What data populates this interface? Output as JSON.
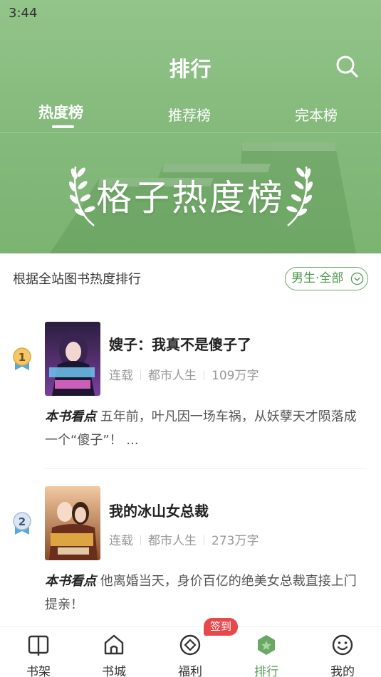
{
  "status_bar": {
    "time": "3:44"
  },
  "header": {
    "title": "排行",
    "tabs": [
      {
        "label": "热度榜",
        "active": true
      },
      {
        "label": "推荐榜",
        "active": false
      },
      {
        "label": "完本榜",
        "active": false
      }
    ],
    "banner_title": "格子热度榜"
  },
  "list": {
    "description": "根据全站图书热度排行",
    "filter_label": "男生·全部"
  },
  "books": [
    {
      "rank": "1",
      "title": "嫂子：我真不是傻子了",
      "status": "连载",
      "category": "都市人生",
      "words": "109万字",
      "blurb_tag": "本书看点",
      "blurb": "五年前，叶凡因一场车祸，从妖孽天才陨落成一个“傻子”！ ..."
    },
    {
      "rank": "2",
      "title": "我的冰山女总裁",
      "status": "连载",
      "category": "都市人生",
      "words": "273万字",
      "blurb_tag": "本书看点",
      "blurb": "他离婚当天，身价百亿的绝美女总裁直接上门提亲！"
    }
  ],
  "bottom_nav": {
    "items": [
      {
        "label": "书架",
        "icon": "bookshelf-icon",
        "active": false
      },
      {
        "label": "书城",
        "icon": "store-home-icon",
        "active": false
      },
      {
        "label": "福利",
        "icon": "welfare-icon",
        "active": false
      },
      {
        "label": "排行",
        "icon": "ranking-icon",
        "active": true
      },
      {
        "label": "我的",
        "icon": "profile-smile-icon",
        "active": false
      }
    ],
    "signin_badge": "签到"
  },
  "colors": {
    "header_green": "#86bb7d",
    "accent_green": "#5a9b57",
    "badge_red": "#e8484b"
  }
}
